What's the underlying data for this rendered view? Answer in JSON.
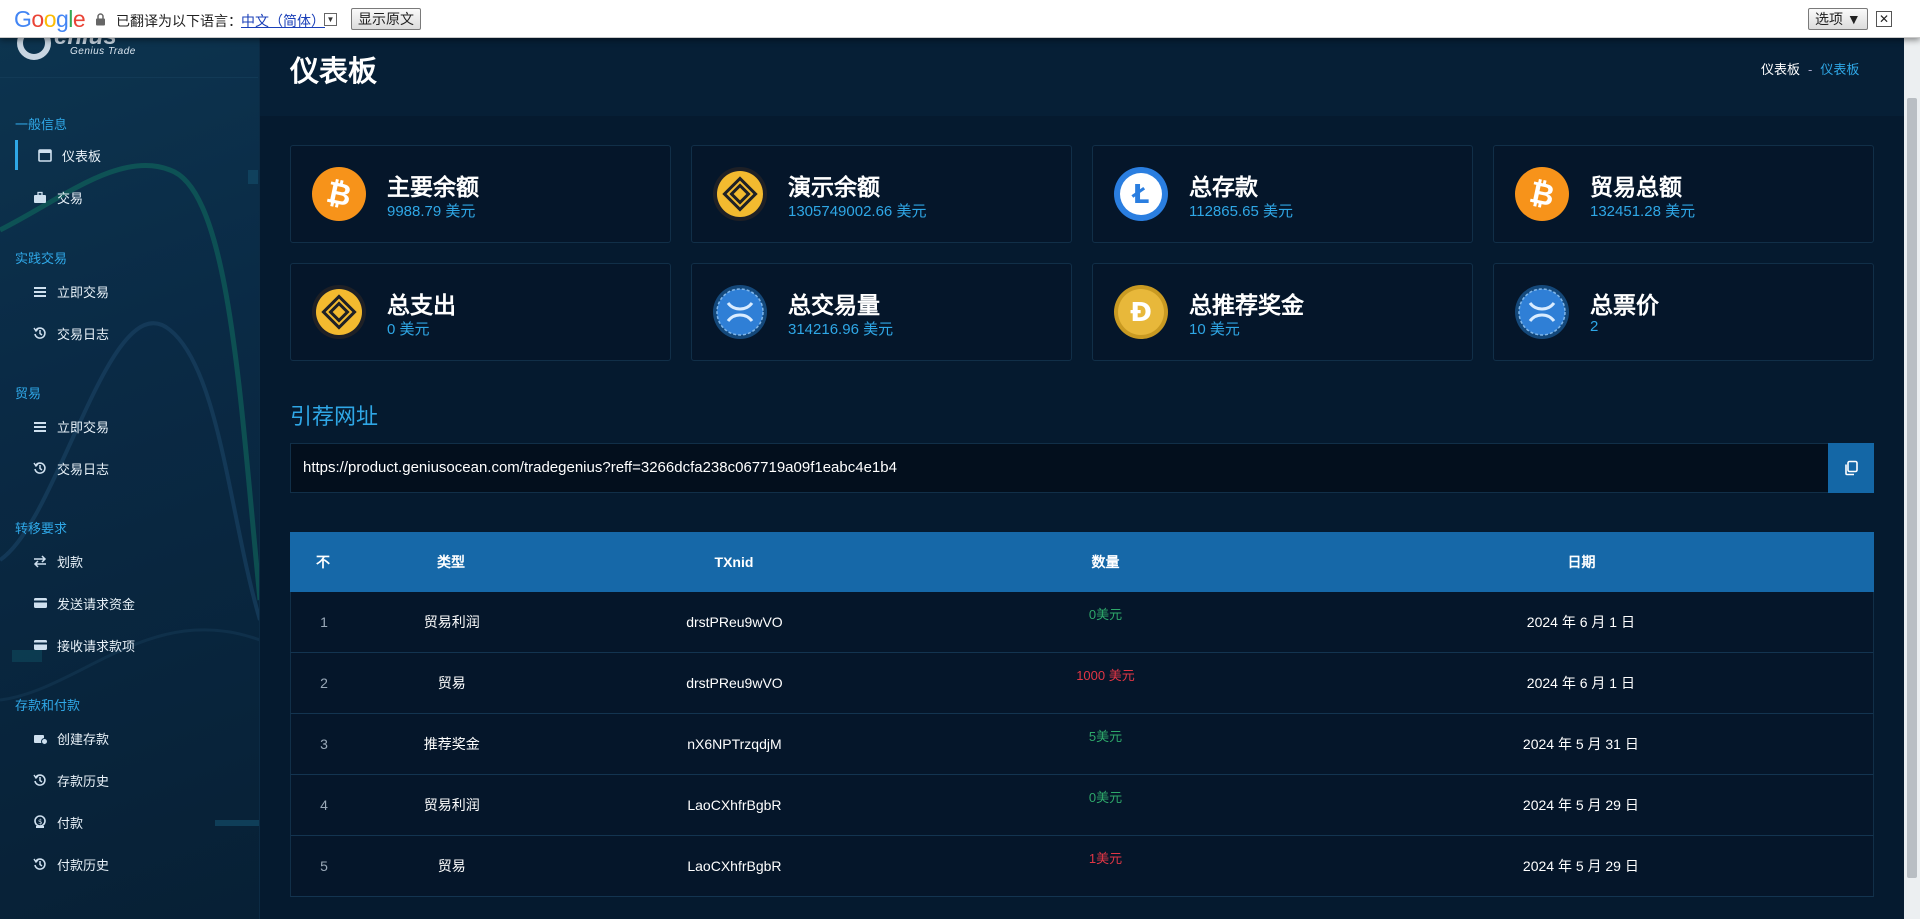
{
  "translate_bar": {
    "logo": "Google",
    "translated_to": "已翻译为以下语言：",
    "language": "中文（简体）",
    "dropdown_arrow": "▼",
    "show_original": "显示原文",
    "options": "选项 ▼",
    "close": "✕"
  },
  "sidebar": {
    "logo_sub": "Genius Trade",
    "sections": [
      {
        "title": "一般信息",
        "items": [
          {
            "label": "仪表板",
            "icon": "dashboard-icon",
            "active": true
          },
          {
            "label": "交易",
            "icon": "briefcase-icon"
          }
        ]
      },
      {
        "title": "实践交易",
        "items": [
          {
            "label": "立即交易",
            "icon": "list-icon"
          },
          {
            "label": "交易日志",
            "icon": "history-icon"
          }
        ]
      },
      {
        "title": "贸易",
        "items": [
          {
            "label": "立即交易",
            "icon": "list-icon"
          },
          {
            "label": "交易日志",
            "icon": "history-icon"
          }
        ]
      },
      {
        "title": "转移要求",
        "items": [
          {
            "label": "划款",
            "icon": "transfer-icon"
          },
          {
            "label": "发送请求资金",
            "icon": "card-icon"
          },
          {
            "label": "接收请求款项",
            "icon": "card-icon"
          }
        ]
      },
      {
        "title": "存款和付款",
        "items": [
          {
            "label": "创建存款",
            "icon": "deposit-icon"
          },
          {
            "label": "存款历史",
            "icon": "history-icon"
          },
          {
            "label": "付款",
            "icon": "payment-icon"
          },
          {
            "label": "付款历史",
            "icon": "history-icon"
          }
        ]
      }
    ]
  },
  "header": {
    "title": "仪表板",
    "breadcrumb": {
      "home": "仪表板",
      "sep": "-",
      "current": "仪表板"
    }
  },
  "cards": [
    {
      "title": "主要余额",
      "value": "9988.79 美元",
      "icon": "bitcoin-icon",
      "color": "#f7931a"
    },
    {
      "title": "演示余额",
      "value": "1305749002.66 美元",
      "icon": "binance-icon",
      "color": "#f3ba2f"
    },
    {
      "title": "总存款",
      "value": "112865.65 美元",
      "icon": "litecoin-icon",
      "color": "#2a7ee0"
    },
    {
      "title": "贸易总额",
      "value": "132451.28 美元",
      "icon": "bitcoin-icon",
      "color": "#f7931a"
    },
    {
      "title": "总支出",
      "value": "0 美元",
      "icon": "binance-icon",
      "color": "#f3ba2f"
    },
    {
      "title": "总交易量",
      "value": "314216.96 美元",
      "icon": "ripple-icon",
      "color": "#2f7fd6"
    },
    {
      "title": "总推荐奖金",
      "value": "10 美元",
      "icon": "dogecoin-icon",
      "color": "#e8b83a"
    },
    {
      "title": "总票价",
      "value": "2",
      "icon": "ripple-icon",
      "color": "#2f7fd6"
    }
  ],
  "referral": {
    "title": "引荐网址",
    "url": "https://product.geniusocean.com/tradegenius?reff=3266dcfa238c067719a09f1eabc4e1b4"
  },
  "table": {
    "headers": [
      "不",
      "类型",
      "TXnid",
      "数量",
      "日期"
    ],
    "rows": [
      {
        "no": "1",
        "type": "贸易利润",
        "txid": "drstPReu9wVO",
        "amount": "0美元",
        "status": "positive",
        "date": "2024 年 6 月 1 日"
      },
      {
        "no": "2",
        "type": "贸易",
        "txid": "drstPReu9wVO",
        "amount": "1000 美元",
        "status": "negative",
        "date": "2024 年 6 月 1 日"
      },
      {
        "no": "3",
        "type": "推荐奖金",
        "txid": "nX6NPTrzqdjM",
        "amount": "5美元",
        "status": "positive",
        "date": "2024 年 5 月 31 日"
      },
      {
        "no": "4",
        "type": "贸易利润",
        "txid": "LaoCXhfrBgbR",
        "amount": "0美元",
        "status": "positive",
        "date": "2024 年 5 月 29 日"
      },
      {
        "no": "5",
        "type": "贸易",
        "txid": "LaoCXhfrBgbR",
        "amount": "1美元",
        "status": "negative",
        "date": "2024 年 5 月 29 日"
      }
    ]
  },
  "colors": {
    "accent": "#2fa7e6",
    "positive": "#2ea86a",
    "negative": "#e13645",
    "table_header": "#1668a8"
  }
}
